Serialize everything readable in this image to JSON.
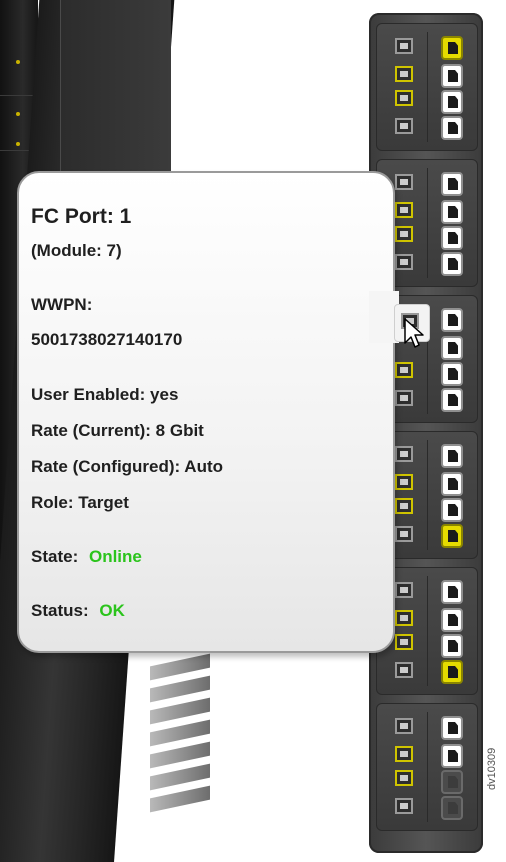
{
  "tooltip": {
    "title": "FC Port: 1",
    "module": "(Module: 7)",
    "wwpn_label": "WWPN:",
    "wwpn_value": "5001738027140170",
    "user_enabled": "User Enabled: yes",
    "rate_current": "Rate (Current): 8 Gbit",
    "rate_configured": "Rate (Configured): Auto",
    "role": "Role: Target",
    "state_label": "State:",
    "state_value": "Online",
    "status_label": "Status:",
    "status_value": "OK"
  },
  "colors": {
    "status_ok": "#2bc41c",
    "port_yellow": "#e5db00",
    "chassis_dark": "#2a2a2a"
  },
  "watermark": "dv10309"
}
